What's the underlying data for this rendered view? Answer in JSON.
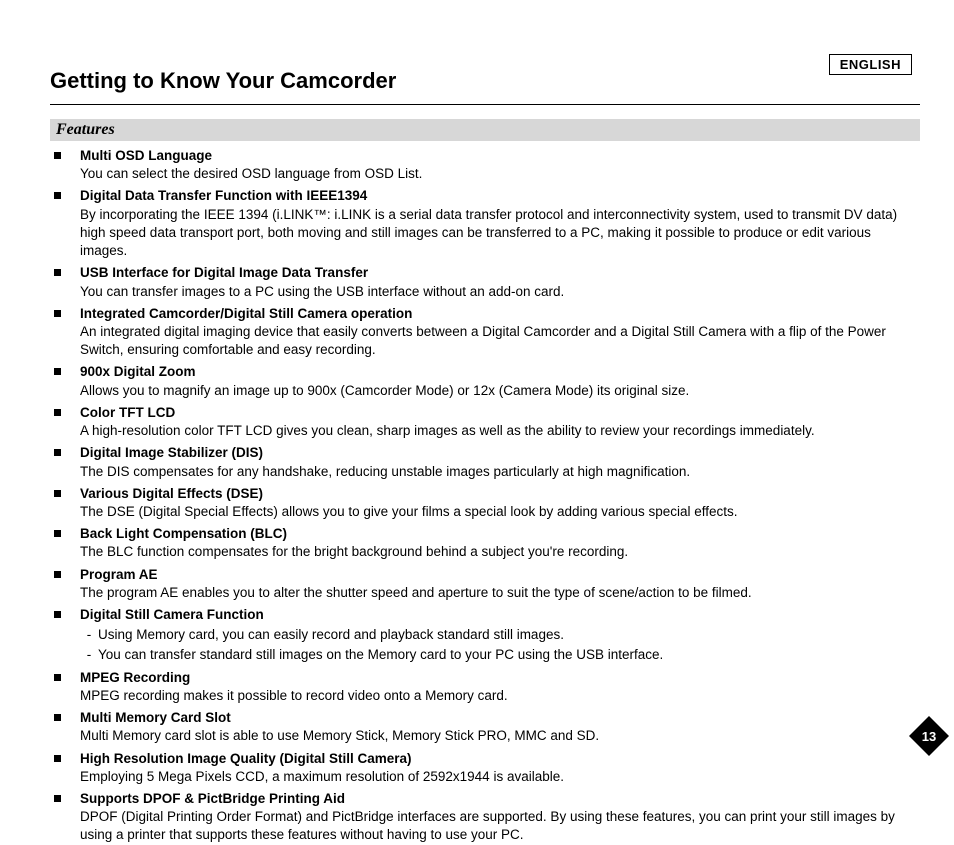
{
  "language_label": "ENGLISH",
  "title": "Getting to Know Your Camcorder",
  "section_heading": "Features",
  "page_number": "13",
  "features": [
    {
      "title": "Multi OSD Language",
      "body": "You can select the desired OSD language from OSD List."
    },
    {
      "title": "Digital Data Transfer Function with IEEE1394",
      "body": "By incorporating the IEEE 1394 (i.LINK™: i.LINK is a serial data transfer protocol and interconnectivity system, used to transmit DV data) high speed data transport port, both moving and still images can be transferred to a PC, making it possible to produce or edit various images."
    },
    {
      "title": "USB Interface for Digital Image Data Transfer",
      "body": "You can transfer images to a PC using the USB interface without an add-on card."
    },
    {
      "title": "Integrated Camcorder/Digital Still Camera operation",
      "body": "An integrated digital imaging device that easily converts between a Digital Camcorder and a Digital Still Camera with a flip of the Power Switch, ensuring comfortable and easy recording."
    },
    {
      "title": "900x Digital Zoom",
      "body": "Allows you to magnify an image up to 900x (Camcorder Mode) or 12x (Camera Mode) its original size."
    },
    {
      "title": "Color TFT LCD",
      "body": "A high-resolution color TFT LCD gives you clean, sharp images as well as the ability to review your recordings immediately."
    },
    {
      "title": "Digital Image Stabilizer (DIS)",
      "body": "The DIS compensates for any handshake, reducing unstable images particularly at high magnification."
    },
    {
      "title": "Various Digital Effects (DSE)",
      "body": "The DSE (Digital Special Effects) allows you to give your films a special look by adding various special effects."
    },
    {
      "title": "Back Light Compensation (BLC)",
      "body": "The BLC function compensates for the bright background behind a subject you're recording."
    },
    {
      "title": "Program AE",
      "body": "The program AE enables you to alter the shutter speed and aperture to suit the type of scene/action to be filmed."
    },
    {
      "title": "Digital Still Camera Function",
      "sub": [
        "Using Memory card, you can easily record and playback standard still images.",
        "You can transfer standard still images on the Memory card to your PC using the USB interface."
      ]
    },
    {
      "title": "MPEG Recording",
      "body": "MPEG recording makes it possible to record video onto a Memory card."
    },
    {
      "title": "Multi Memory Card Slot",
      "body": "Multi Memory card slot is able to use Memory Stick, Memory Stick PRO, MMC and SD."
    },
    {
      "title": "High Resolution Image Quality (Digital Still Camera)",
      "body": "Employing 5 Mega Pixels CCD, a maximum resolution of 2592x1944 is available."
    },
    {
      "title": "Supports DPOF & PictBridge Printing Aid",
      "body": "DPOF (Digital Printing Order Format) and PictBridge interfaces are supported. By using these features, you can print your still images by using a printer that supports these features without having to use your PC."
    }
  ]
}
